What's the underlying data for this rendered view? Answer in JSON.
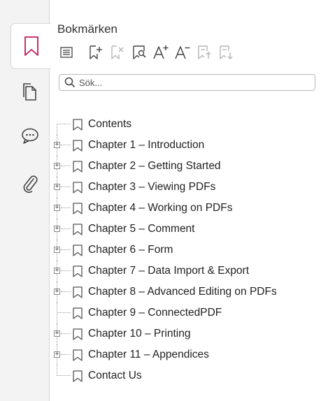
{
  "panel": {
    "title": "Bokmärken",
    "search_placeholder": "Sök..."
  },
  "rail": {
    "tabs": [
      {
        "icon": "bookmark-icon",
        "active": true
      },
      {
        "icon": "pages-icon",
        "active": false
      },
      {
        "icon": "comment-icon",
        "active": false
      },
      {
        "icon": "attachment-icon",
        "active": false
      }
    ]
  },
  "toolbar": {
    "buttons": [
      {
        "icon": "expand-collapse-icon",
        "enabled": true
      },
      {
        "icon": "add-bookmark-icon",
        "enabled": true
      },
      {
        "icon": "delete-bookmark-icon",
        "enabled": false
      },
      {
        "icon": "find-bookmark-icon",
        "enabled": true
      },
      {
        "icon": "increase-font-icon",
        "enabled": true
      },
      {
        "icon": "decrease-font-icon",
        "enabled": true
      },
      {
        "icon": "move-up-icon",
        "enabled": false
      },
      {
        "icon": "move-down-icon",
        "enabled": false
      }
    ]
  },
  "bookmarks": [
    {
      "label": "Contents",
      "expandable": false
    },
    {
      "label": "Chapter 1 – Introduction",
      "expandable": true
    },
    {
      "label": "Chapter 2 – Getting Started",
      "expandable": true
    },
    {
      "label": "Chapter 3 – Viewing PDFs",
      "expandable": true
    },
    {
      "label": "Chapter 4 – Working on PDFs",
      "expandable": true
    },
    {
      "label": "Chapter 5 – Comment",
      "expandable": true
    },
    {
      "label": "Chapter 6 – Form",
      "expandable": true
    },
    {
      "label": "Chapter 7 – Data Import & Export",
      "expandable": true
    },
    {
      "label": "Chapter 8 – Advanced Editing on PDFs",
      "expandable": true
    },
    {
      "label": "Chapter 9 – ConnectedPDF",
      "expandable": false
    },
    {
      "label": "Chapter 10 – Printing",
      "expandable": true
    },
    {
      "label": "Chapter 11 – Appendices",
      "expandable": true
    },
    {
      "label": "Contact Us",
      "expandable": false
    }
  ],
  "colors": {
    "accent": "#c2185b",
    "icon": "#444444",
    "disabled_icon": "#b5b5b5"
  }
}
